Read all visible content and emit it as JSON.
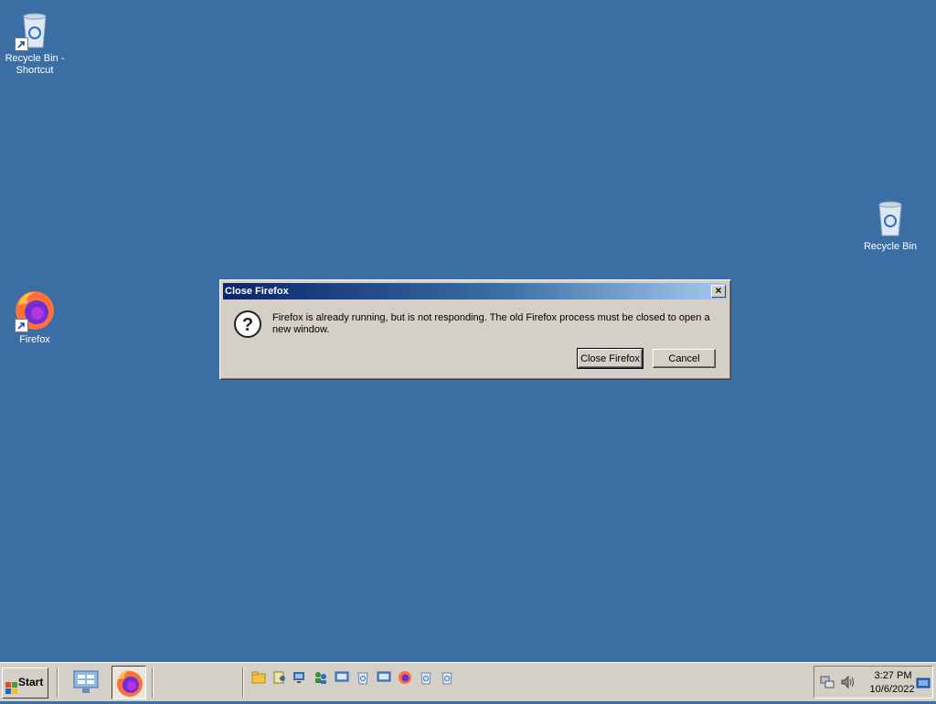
{
  "desktop": {
    "icons": [
      {
        "label": "Recycle Bin - Shortcut",
        "icon": "recycle-bin-icon"
      },
      {
        "label": "Firefox",
        "icon": "firefox-icon"
      },
      {
        "label": "Recycle Bin",
        "icon": "recycle-bin-icon"
      }
    ]
  },
  "dialog": {
    "title": "Close Firefox",
    "message": "Firefox is already running, but is not responding. The old Firefox process must be closed to open a new window.",
    "close_glyph": "×",
    "buttons": {
      "confirm": "Close Firefox",
      "cancel": "Cancel"
    },
    "icon": "question-icon"
  },
  "taskbar": {
    "start_label": "Start",
    "quick_launch": [
      "server-manager-icon",
      "firefox-icon"
    ],
    "tray_apps": [
      "explorer-icon",
      "user-icon",
      "network-icon",
      "people-icon",
      "remote-icon",
      "recycle-icon",
      "remote-icon",
      "firefox-icon",
      "recycle-icon",
      "recycle-icon"
    ],
    "clock": {
      "time": "3:27 PM",
      "date": "10/6/2022"
    }
  },
  "colors": {
    "desktop": "#3a6ea5",
    "titlebar_start": "#0a246a",
    "titlebar_end": "#a6caf0",
    "face": "#d4d0c8"
  }
}
